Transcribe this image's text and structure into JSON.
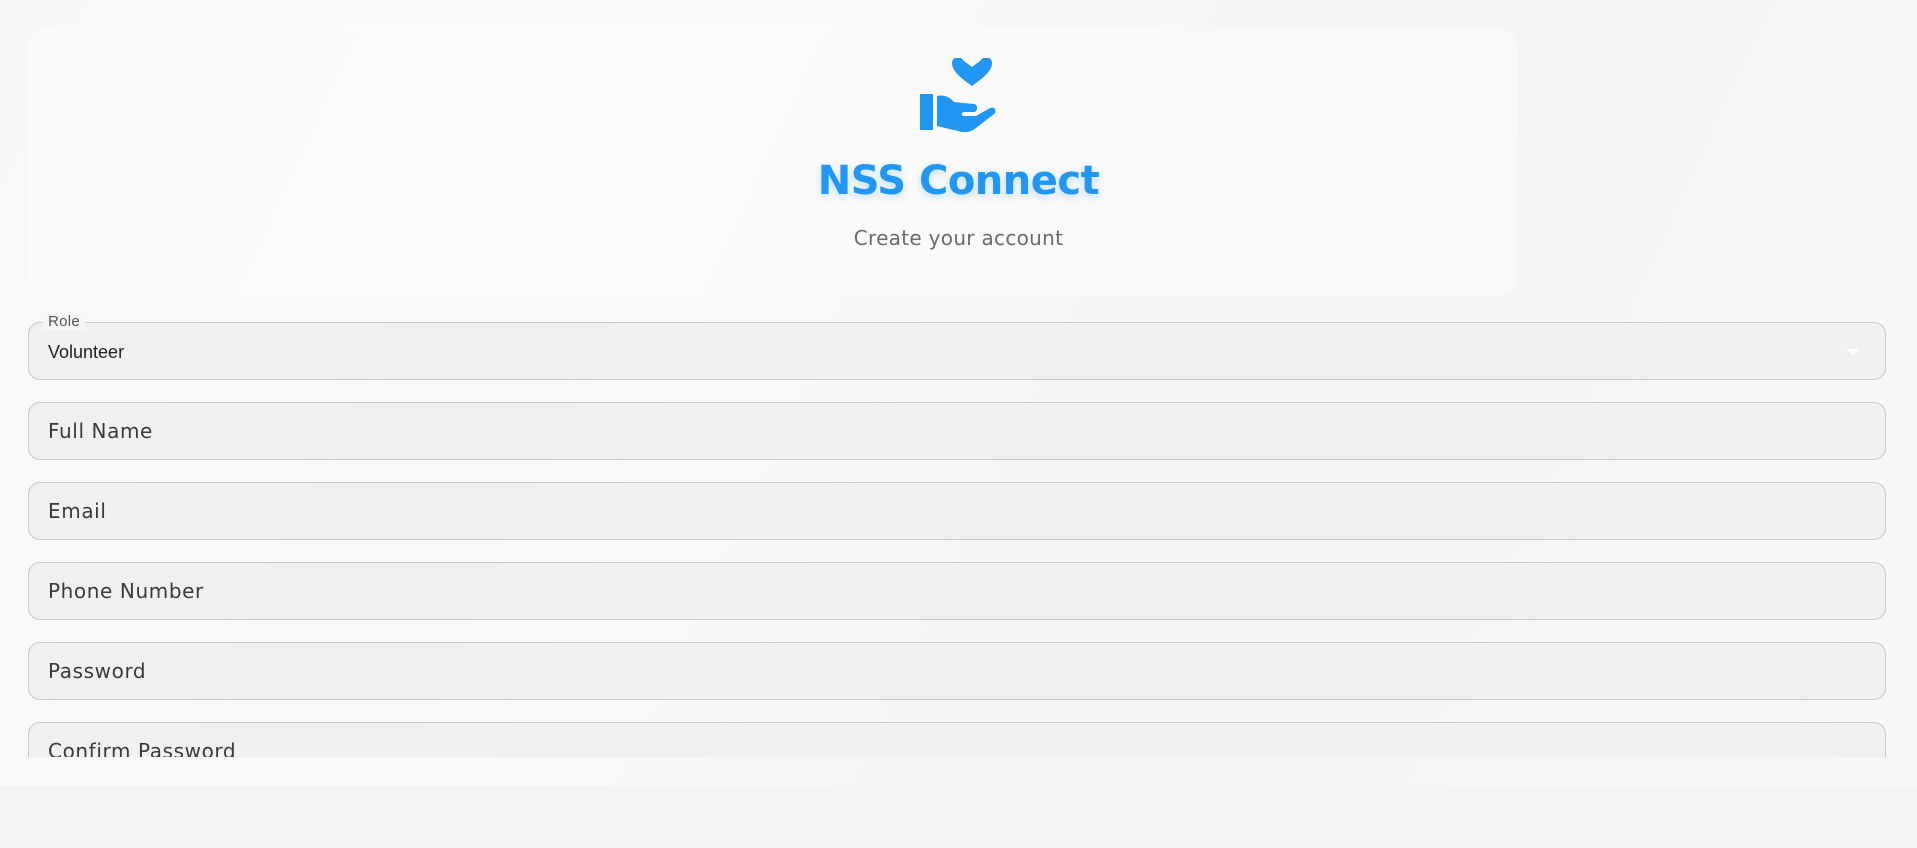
{
  "app": {
    "title": "NSS Connect",
    "subtitle": "Create your account",
    "logo_icon": "hand-holding-heart-icon",
    "accent_color": "#2196f3"
  },
  "form": {
    "role": {
      "label": "Role",
      "value": "Volunteer"
    },
    "full_name": {
      "placeholder": "Full Name"
    },
    "email": {
      "placeholder": "Email"
    },
    "phone": {
      "placeholder": "Phone Number"
    },
    "password": {
      "placeholder": "Password"
    },
    "confirm_password": {
      "placeholder": "Confirm Password"
    }
  }
}
